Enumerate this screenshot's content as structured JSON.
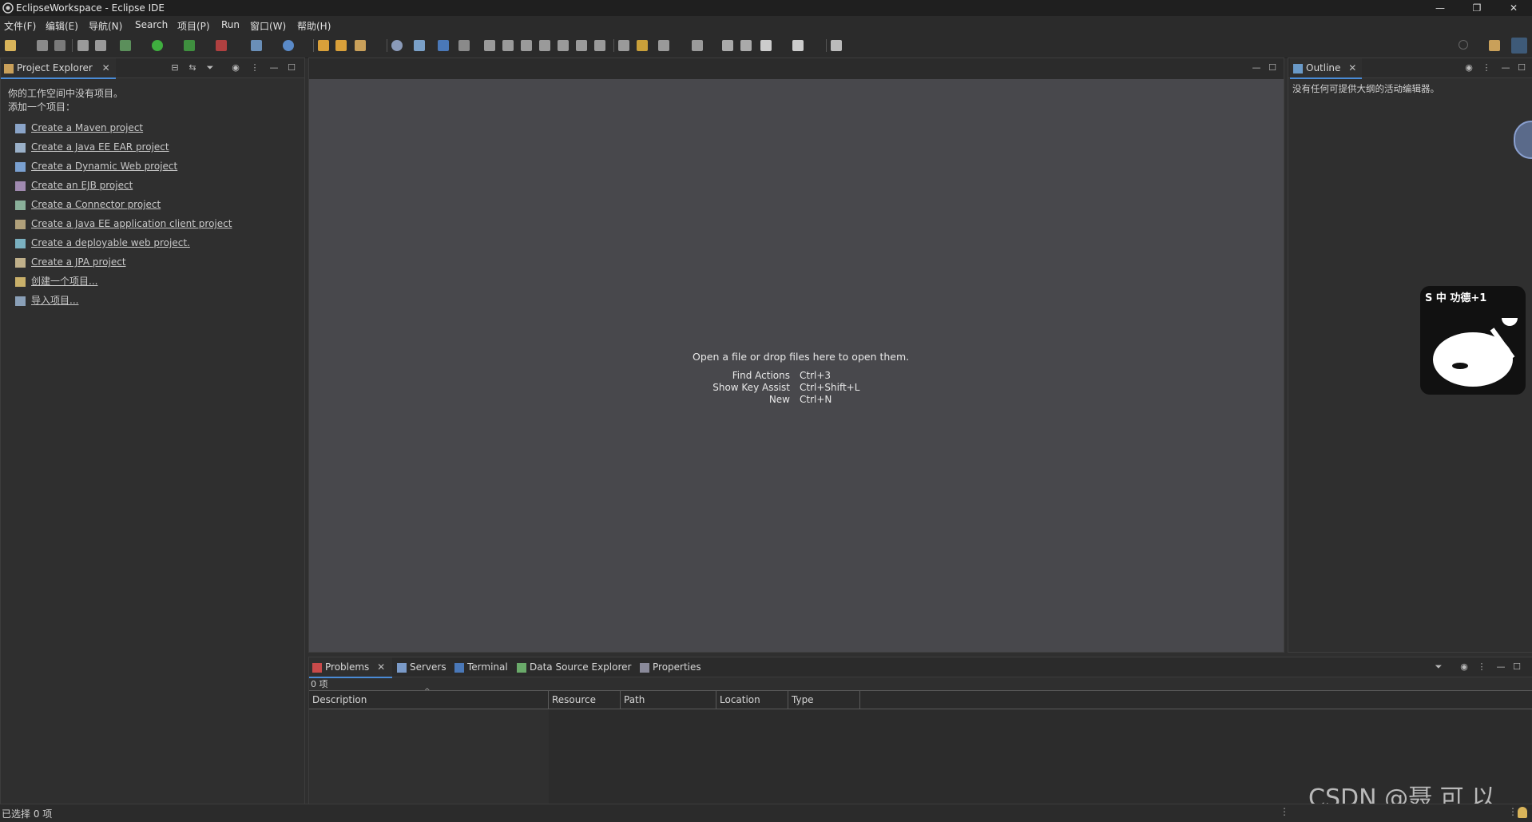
{
  "window": {
    "title": "EclipseWorkspace - Eclipse IDE"
  },
  "menu": [
    "文件(F)",
    "编辑(E)",
    "导航(N)",
    "Search",
    "项目(P)",
    "Run",
    "窗口(W)",
    "帮助(H)"
  ],
  "project_explorer": {
    "tab_label": "Project Explorer",
    "empty_line1": "你的工作空间中没有项目。",
    "empty_line2": "添加一个项目：",
    "links": [
      "Create a Maven project",
      "Create a Java EE EAR project",
      "Create a Dynamic Web project",
      "Create an EJB project",
      "Create a Connector project",
      "Create a Java EE application client project",
      "Create a deployable web project.",
      "Create a JPA project",
      "创建一个项目...",
      "导入项目..."
    ]
  },
  "editor": {
    "hint": "Open a file or drop files here to open them.",
    "shortcuts": [
      {
        "label": "Find Actions",
        "key": "Ctrl+3"
      },
      {
        "label": "Show Key Assist",
        "key": "Ctrl+Shift+L"
      },
      {
        "label": "New",
        "key": "Ctrl+N"
      }
    ]
  },
  "outline": {
    "tab_label": "Outline",
    "message": "没有任何可提供大纲的活动编辑器。"
  },
  "bottom_panel": {
    "tabs": [
      "Problems",
      "Servers",
      "Terminal",
      "Data Source Explorer",
      "Properties"
    ],
    "count": "0 项",
    "columns": [
      "Description",
      "Resource",
      "Path",
      "Location",
      "Type"
    ]
  },
  "status": {
    "selection": "已选择 0 项"
  },
  "watermark": "CSDN @聂 可 以",
  "sticker": {
    "text": "S 中 功德+1"
  },
  "colors": {
    "accent": "#4a8bd6",
    "editor_bg": "#48484c",
    "panel_bg": "#2f2f2f"
  }
}
